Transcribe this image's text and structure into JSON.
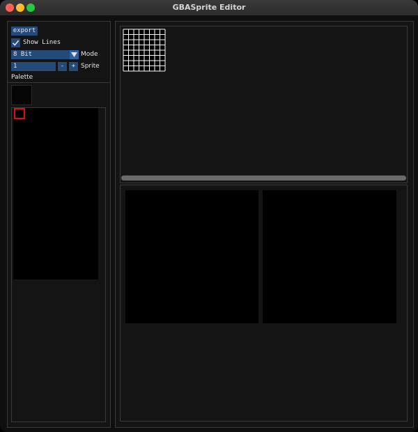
{
  "window": {
    "title": "GBASprite Editor"
  },
  "toolbar": {
    "export_label": "export"
  },
  "options": {
    "show_lines": {
      "label": "Show Lines",
      "checked": true
    },
    "mode": {
      "selected": "8 Bit",
      "label": "Mode"
    },
    "sprite": {
      "value": "1",
      "minus_label": "-",
      "plus_label": "+",
      "label": "Sprite"
    }
  },
  "palette": {
    "label": "Palette",
    "selected_color": "#000000"
  },
  "editor": {
    "grid_cells": 8,
    "grid_line_color": "#ffffff"
  },
  "colors": {
    "accent": "#244a7a",
    "selection": "#e01010"
  },
  "icons": {
    "checkbox": "check-icon",
    "dropdown": "triangle-down-icon"
  }
}
